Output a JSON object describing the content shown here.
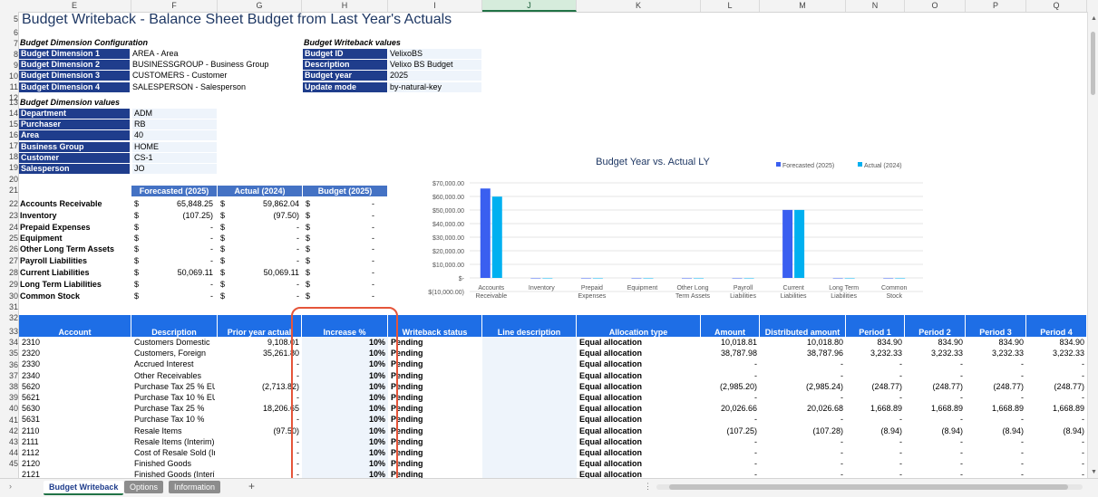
{
  "columns": [
    "E",
    "F",
    "G",
    "H",
    "I",
    "J",
    "K",
    "L",
    "M",
    "N",
    "O",
    "P",
    "Q"
  ],
  "selected_column": "J",
  "title": "Budget Writeback - Balance Sheet Budget from Last Year's Actuals",
  "dim_config": {
    "heading": "Budget Dimension Configuration",
    "rows": [
      {
        "label": "Budget Dimension 1",
        "value": "AREA - Area"
      },
      {
        "label": "Budget Dimension 2",
        "value": "BUSINESSGROUP - Business Group"
      },
      {
        "label": "Budget Dimension 3",
        "value": "CUSTOMERS - Customer"
      },
      {
        "label": "Budget Dimension 4",
        "value": "SALESPERSON - Salesperson"
      }
    ]
  },
  "writeback_values": {
    "heading": "Budget Writeback values",
    "rows": [
      {
        "label": "Budget ID",
        "value": "VelixoBS"
      },
      {
        "label": "Description",
        "value": "Velixo BS Budget"
      },
      {
        "label": "Budget year",
        "value": "2025"
      },
      {
        "label": "Update mode",
        "value": "by-natural-key"
      }
    ]
  },
  "dim_values": {
    "heading": "Budget Dimension values",
    "rows": [
      {
        "label": "Department",
        "value": "ADM"
      },
      {
        "label": "Purchaser",
        "value": "RB"
      },
      {
        "label": "Area",
        "value": "40"
      },
      {
        "label": "Business Group",
        "value": "HOME"
      },
      {
        "label": "Customer",
        "value": "CS-1"
      },
      {
        "label": "Salesperson",
        "value": "JO"
      }
    ]
  },
  "summary": {
    "headers": [
      "Forecasted (2025)",
      "Actual (2024)",
      "Budget (2025)"
    ],
    "currency": "$",
    "rows": [
      {
        "label": "Accounts Receivable",
        "f": "65,848.25",
        "a": "59,862.04",
        "b": "-"
      },
      {
        "label": "Inventory",
        "f": "(107.25)",
        "a": "(97.50)",
        "b": "-"
      },
      {
        "label": "Prepaid Expenses",
        "f": "-",
        "a": "-",
        "b": "-"
      },
      {
        "label": "Equipment",
        "f": "-",
        "a": "-",
        "b": "-"
      },
      {
        "label": "Other Long Term Assets",
        "f": "-",
        "a": "-",
        "b": "-"
      },
      {
        "label": "Payroll Liabilities",
        "f": "-",
        "a": "-",
        "b": "-"
      },
      {
        "label": "Current Liabilities",
        "f": "50,069.11",
        "a": "50,069.11",
        "b": "-"
      },
      {
        "label": "Long Term Liabilities",
        "f": "-",
        "a": "-",
        "b": "-"
      },
      {
        "label": "Common Stock",
        "f": "-",
        "a": "-",
        "b": "-"
      }
    ]
  },
  "chart_data": {
    "type": "bar",
    "title": "Budget Year vs. Actual LY",
    "categories": [
      "Accounts Receivable",
      "Inventory",
      "Prepaid Expenses",
      "Equipment",
      "Other Long Term Assets",
      "Payroll Liabilities",
      "Current Liabilities",
      "Long Term Liabilities",
      "Common Stock"
    ],
    "series": [
      {
        "name": "Forecasted (2025)",
        "color": "#3a5ff0",
        "values": [
          65848.25,
          -107.25,
          0,
          0,
          0,
          0,
          50069.11,
          0,
          0
        ]
      },
      {
        "name": "Actual (2024)",
        "color": "#00b0f0",
        "values": [
          59862.04,
          -97.5,
          0,
          0,
          0,
          0,
          50069.11,
          0,
          0
        ]
      }
    ],
    "ylim": [
      -10000,
      70000
    ],
    "yticks": [
      "$70,000.00",
      "$60,000.00",
      "$50,000.00",
      "$40,000.00",
      "$30,000.00",
      "$20,000.00",
      "$10,000.00",
      "$-",
      "$(10,000.00)"
    ],
    "legend": "top-right",
    "grid": true
  },
  "table": {
    "headers": [
      "Account",
      "Description",
      "Prior year actual",
      "Increase %",
      "Writeback status",
      "Line description",
      "Allocation type",
      "Amount",
      "Distributed amount",
      "Period 1",
      "Period 2",
      "Period 3",
      "Period 4"
    ],
    "rows": [
      [
        "2310",
        "Customers Domestic",
        "9,108.01",
        "10%",
        "Pending",
        "",
        "Equal allocation",
        "10,018.81",
        "10,018.80",
        "834.90",
        "834.90",
        "834.90",
        "834.90"
      ],
      [
        "2320",
        "Customers, Foreign",
        "35,261.80",
        "10%",
        "Pending",
        "",
        "Equal allocation",
        "38,787.98",
        "38,787.96",
        "3,232.33",
        "3,232.33",
        "3,232.33",
        "3,232.33"
      ],
      [
        "2330",
        "Accrued Interest",
        "-",
        "10%",
        "Pending",
        "",
        "Equal allocation",
        "-",
        "-",
        "-",
        "-",
        "-",
        "-"
      ],
      [
        "2340",
        "Other Receivables",
        "-",
        "10%",
        "Pending",
        "",
        "Equal allocation",
        "-",
        "-",
        "-",
        "-",
        "-",
        "-"
      ],
      [
        "5620",
        "Purchase Tax 25 % EU",
        "(2,713.82)",
        "10%",
        "Pending",
        "",
        "Equal allocation",
        "(2,985.20)",
        "(2,985.24)",
        "(248.77)",
        "(248.77)",
        "(248.77)",
        "(248.77)"
      ],
      [
        "5621",
        "Purchase Tax 10 % EU",
        "-",
        "10%",
        "Pending",
        "",
        "Equal allocation",
        "-",
        "-",
        "-",
        "-",
        "-",
        "-"
      ],
      [
        "5630",
        "Purchase Tax 25 %",
        "18,206.65",
        "10%",
        "Pending",
        "",
        "Equal allocation",
        "20,026.66",
        "20,026.68",
        "1,668.89",
        "1,668.89",
        "1,668.89",
        "1,668.89"
      ],
      [
        "5631",
        "Purchase Tax 10 %",
        "-",
        "10%",
        "Pending",
        "",
        "Equal allocation",
        "-",
        "-",
        "-",
        "-",
        "-",
        "-"
      ],
      [
        "2110",
        "Resale Items",
        "(97.50)",
        "10%",
        "Pending",
        "",
        "Equal allocation",
        "(107.25)",
        "(107.28)",
        "(8.94)",
        "(8.94)",
        "(8.94)",
        "(8.94)"
      ],
      [
        "2111",
        "Resale Items (Interim)",
        "-",
        "10%",
        "Pending",
        "",
        "Equal allocation",
        "-",
        "-",
        "-",
        "-",
        "-",
        "-"
      ],
      [
        "2112",
        "Cost of Resale Sold (In",
        "-",
        "10%",
        "Pending",
        "",
        "Equal allocation",
        "-",
        "-",
        "-",
        "-",
        "-",
        "-"
      ],
      [
        "2120",
        "Finished Goods",
        "-",
        "10%",
        "Pending",
        "",
        "Equal allocation",
        "-",
        "-",
        "-",
        "-",
        "-",
        "-"
      ],
      [
        "2121",
        "Finished Goods (Interi)",
        "-",
        "10%",
        "Pending",
        "",
        "Equal allocation",
        "-",
        "-",
        "-",
        "-",
        "-",
        "-"
      ]
    ]
  },
  "sheet_tabs": [
    {
      "label": "Budget Writeback",
      "active": true
    },
    {
      "label": "Options",
      "active": false
    },
    {
      "label": "Information",
      "active": false
    }
  ],
  "add_sheet": "+"
}
